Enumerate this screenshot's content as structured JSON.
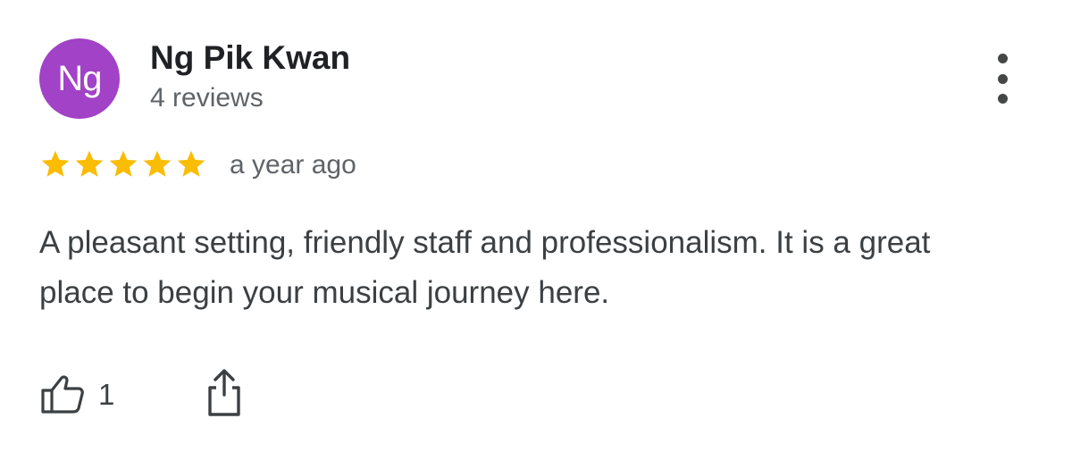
{
  "review": {
    "avatar": {
      "initials": "Ng",
      "color": "#a142c7"
    },
    "author_name": "Ng Pik Kwan",
    "review_count": "4 reviews",
    "rating": 5,
    "rating_max": 5,
    "star_color": "#fbbc04",
    "time_ago": "a year ago",
    "text": "A pleasant setting, friendly staff and professionalism. It is a great place to begin your musical journey here.",
    "likes": "1",
    "icons": {
      "more": "more-vert-icon",
      "like": "thumbs-up-icon",
      "share": "share-icon"
    }
  }
}
